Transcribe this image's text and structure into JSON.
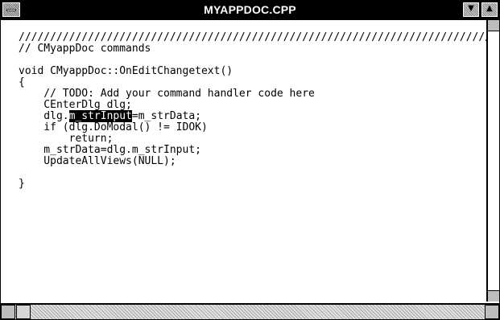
{
  "window": {
    "title": "MYAPPDOC.CPP"
  },
  "editor": {
    "lines": [
      "////////////////////////////////////////////////////////////////////////////",
      "// CMyappDoc commands",
      "",
      "void CMyappDoc::OnEditChangetext()",
      "{",
      "    // TODO: Add your command handler code here",
      "    CEnterDlg dlg;",
      "    dlg.",
      "m_strInput",
      "=m_strData;",
      "    if (dlg.DoModal() != IDOK)",
      "        return;",
      "    m_strData=dlg.m_strInput;",
      "    UpdateAllViews(NULL);",
      "",
      "}"
    ]
  },
  "icons": {
    "system_menu": "system-menu-icon",
    "minimize": "minimize-icon",
    "maximize": "maximize-icon",
    "scroll_up": "scroll-up-icon",
    "scroll_down": "scroll-down-icon",
    "scroll_left": "scroll-left-icon",
    "scroll_right": "scroll-right-icon"
  }
}
